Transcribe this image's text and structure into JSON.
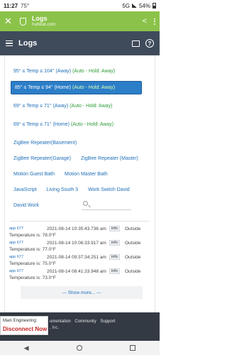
{
  "status": {
    "time": "11:27",
    "temp": "75°",
    "network": "5G",
    "battery": "54%"
  },
  "browser": {
    "title": "Logs",
    "url": "hubitat.com"
  },
  "app": {
    "title": "Logs"
  },
  "filters": [
    {
      "prefix": "95° ≤ Temp ≤ 104° (Away)",
      "suffix": "(Auto - Hold: Away)"
    },
    {
      "prefix": "85° ≤ Temp ≤ 94° (Home)",
      "suffix": "(Auto - Hold: Away)"
    },
    {
      "prefix": "69° ≤ Temp ≤ 71° (Away)",
      "suffix": "(Auto - Hold: Away)"
    },
    {
      "prefix": "69° ≤ Temp ≤ 71° (Home)",
      "suffix": "(Auto - Hold: Away)"
    },
    {
      "label": "ZigBee Repeater(Basement)"
    },
    {
      "label": "ZigBee Repeater(Garage)"
    },
    {
      "label": "ZigBee Repeater (Master)"
    },
    {
      "label": "Motion Guest Bath"
    },
    {
      "label": "Motion Master Bath"
    },
    {
      "label": "JavaScript"
    },
    {
      "label": "Living South 3"
    },
    {
      "label": "Work Switch David"
    },
    {
      "label": "David Work"
    }
  ],
  "logs": [
    {
      "source": "app 677",
      "timestamp": "2021-08-14 10:35:43.736 am",
      "level": "info",
      "device": "Outside",
      "message": "Temperature is: 78.0°F"
    },
    {
      "source": "app 677",
      "timestamp": "2021-08-14 10:06:33.917 am",
      "level": "info",
      "device": "Outside",
      "message": "Temperature is: 77.0°F"
    },
    {
      "source": "app 677",
      "timestamp": "2021-08-14 09:37:34.251 am",
      "level": "info",
      "device": "Outside",
      "message": "Temperature is: 75.0°F"
    },
    {
      "source": "app 677",
      "timestamp": "2021-08-14 08:41:33.948 am",
      "level": "info",
      "device": "Outside",
      "message": "Temperature is: 73.0°F"
    }
  ],
  "show_more": "--- Show more... ---",
  "footer": {
    "link1": "umentation",
    "link2": "Community",
    "link3": "Support",
    "copy": ", Inc."
  },
  "toast": {
    "line1": "Main Engineering:",
    "line2": "Disconnect Now"
  },
  "nav": {
    "back": "◀"
  }
}
